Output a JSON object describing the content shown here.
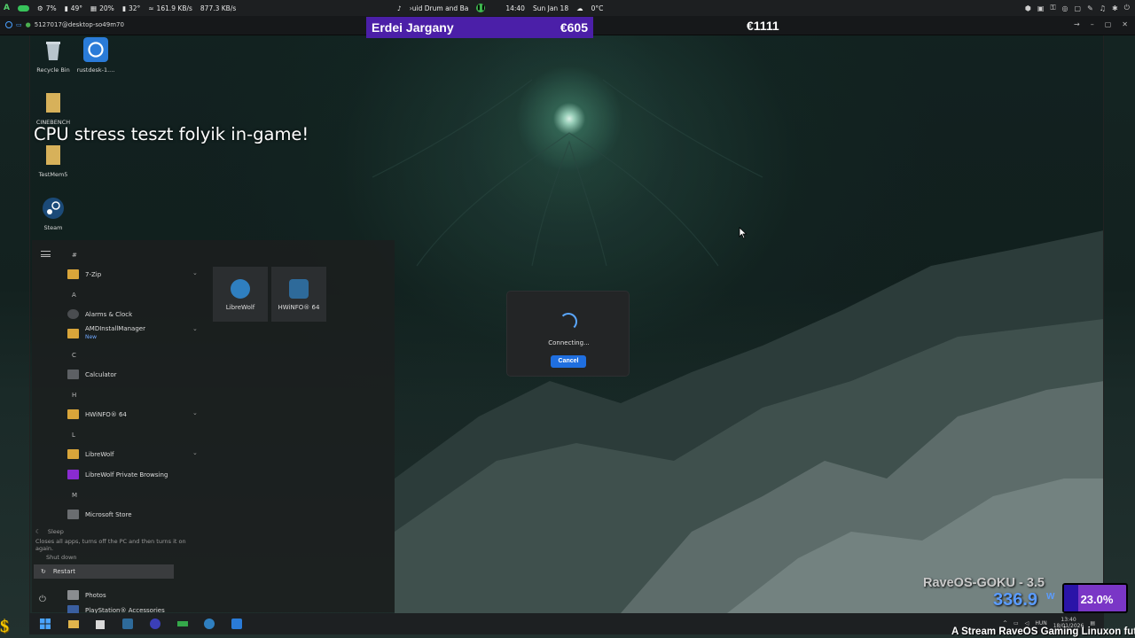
{
  "host_topbar": {
    "cpu_pct": "7%",
    "cpu_temp": "49°",
    "gpu_pct": "20%",
    "gpu_temp": "32°",
    "net_down": "161.9 KB/s",
    "net_up": "877.3 KB/s",
    "media_title": "›uid Drum and Ba",
    "time": "14:40",
    "date": "Sun Jan 18",
    "weather": "0°C"
  },
  "remote_window": {
    "title": "5127017@desktop-so49m70"
  },
  "stream_overlay": {
    "donor_name": "Erdei Jargany",
    "donor_amount": "€605",
    "total_amount": "€1111",
    "cpu_stress_text": "CPU stress teszt folyik in-game!",
    "system_name": "RaveOS-GOKU - 3.5",
    "power_value": "336.9",
    "power_unit": "W",
    "percent": "23.0%",
    "percent_value": 0.23,
    "ticker": "A Stream RaveOS Gaming Linuxon fut"
  },
  "desktop_icons": [
    {
      "label": "Recycle Bin",
      "icon": "recycle-bin-icon"
    },
    {
      "label": "rustdesk-1....",
      "icon": "rustdesk-icon"
    },
    {
      "label": "CINEBENCH",
      "icon": "cinebench-folder-icon"
    },
    {
      "label": "TestMem5",
      "icon": "testmem-folder-icon"
    },
    {
      "label": "Steam",
      "icon": "steam-icon"
    }
  ],
  "start_menu": {
    "letters": [
      "#",
      "A",
      "C",
      "H",
      "L",
      "M"
    ],
    "apps": [
      {
        "label": "7-Zip",
        "icon": "folder-icon",
        "expandable": true
      },
      {
        "label": "Alarms & Clock",
        "icon": "alarm-clock-icon"
      },
      {
        "label": "AMDInstallManager",
        "sub": "New",
        "icon": "folder-icon",
        "expandable": true
      },
      {
        "label": "Calculator",
        "icon": "calculator-icon"
      },
      {
        "label": "HWiNFO® 64",
        "icon": "folder-icon",
        "expandable": true
      },
      {
        "label": "LibreWolf",
        "icon": "folder-icon",
        "expandable": true
      },
      {
        "label": "LibreWolf Private Browsing",
        "icon": "librewolf-private-icon"
      },
      {
        "label": "Microsoft Store",
        "icon": "store-icon"
      },
      {
        "label": "Photos",
        "icon": "photos-icon"
      },
      {
        "label": "PlayStation® Accessories",
        "icon": "playstation-icon"
      }
    ],
    "pinned": [
      {
        "label": "LibreWolf",
        "icon": "librewolf-icon"
      },
      {
        "label": "HWiNFO® 64",
        "icon": "hwinfo-icon"
      }
    ],
    "power": {
      "sleep": "Sleep",
      "tooltip": "Closes all apps, turns off the PC and then turns it on again.",
      "shutdown": "Shut down",
      "restart": "Restart"
    }
  },
  "dialog": {
    "status": "Connecting...",
    "cancel_label": "Cancel"
  },
  "tray": {
    "lang": "HUN",
    "time": "13:40",
    "date": "18/01/2026"
  },
  "colors": {
    "overlay_purple": "#4b1fa8",
    "accent_blue": "#1f6fe0",
    "power_blue": "#5b9cff",
    "percent_box": "#7a36c6"
  }
}
